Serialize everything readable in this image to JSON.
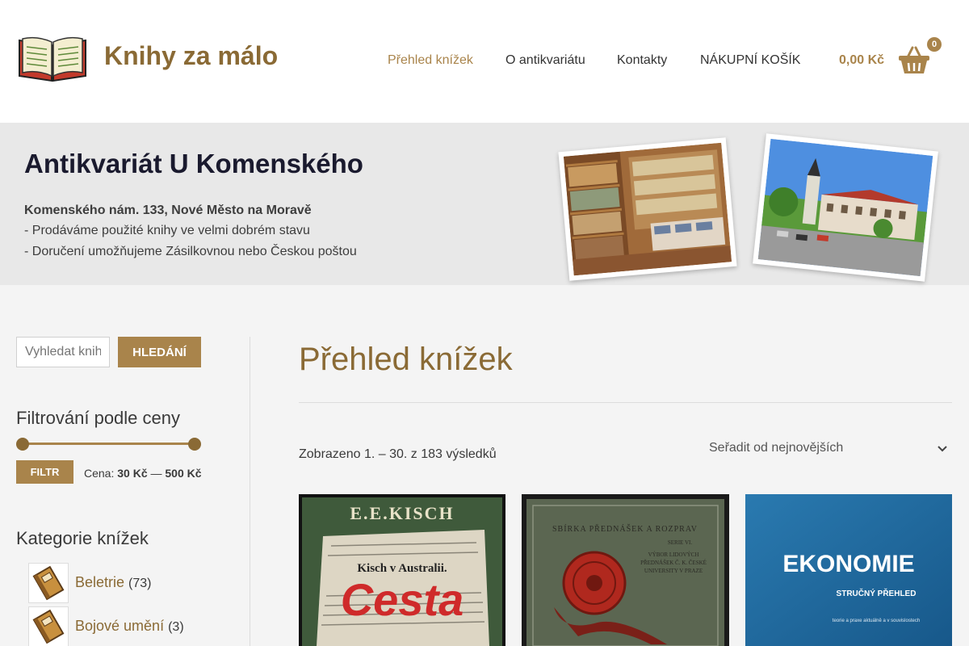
{
  "header": {
    "site_title": "Knihy za málo",
    "nav": [
      {
        "label": "Přehled knížek",
        "active": true
      },
      {
        "label": "O antikvariátu",
        "active": false
      },
      {
        "label": "Kontakty",
        "active": false
      },
      {
        "label": "NÁKUPNÍ KOŠÍK",
        "active": false
      }
    ],
    "cart_total": "0,00 Kč",
    "cart_count": "0"
  },
  "hero": {
    "title": "Antikvariát U Komenského",
    "address": "Komenského nám. 133, Nové Město na Moravě",
    "line1": "- Prodáváme použité knihy ve velmi dobrém stavu",
    "line2": "- Doručení umožňujeme Zásilkovnou nebo Českou poštou"
  },
  "sidebar": {
    "search_placeholder": "Vyhledat knihy…",
    "search_button": "HLEDÁNÍ",
    "price_filter_title": "Filtrování podle ceny",
    "filter_button": "FILTR",
    "price_prefix": "Cena:",
    "price_min": "30 Kč",
    "price_sep": "—",
    "price_max": "500 Kč",
    "categories_title": "Kategorie knížek",
    "categories": [
      {
        "name": "Beletrie",
        "count": "(73)"
      },
      {
        "name": "Bojové umění",
        "count": "(3)"
      }
    ]
  },
  "main": {
    "page_title": "Přehled knížek",
    "result_count": "Zobrazeno 1. – 30. z 183 výsledků",
    "sort_selected": "Seřadit od nejnovějších",
    "products": [
      {
        "cover_author": "E.E.KISCH",
        "cover_title": "Cesta",
        "cover_sub": "Kisch v Australii.",
        "cover_color": "#3f5a3b"
      },
      {
        "cover_author": "SBÍRKA PŘEDNÁŠEK A ROZPRAV",
        "cover_series": "SERIE VI.",
        "cover_sub": "VÝBOR LIDOVÝCH PŘEDNÁŠEK Č. K. ČESKÉ UNIVERSITY V PRAZE",
        "cover_color": "#5b6651"
      },
      {
        "cover_title": "EKONOMIE",
        "cover_sub": "STRUČNÝ PŘEHLED",
        "cover_note": "teorie a praxe aktuálně a v souvislostech",
        "cover_color": "#1f6ca0"
      }
    ]
  },
  "colors": {
    "accent": "#a9844b",
    "title": "#8a6a35",
    "hero_bg": "#e8e8e8",
    "page_bg": "#f4f4f4"
  }
}
